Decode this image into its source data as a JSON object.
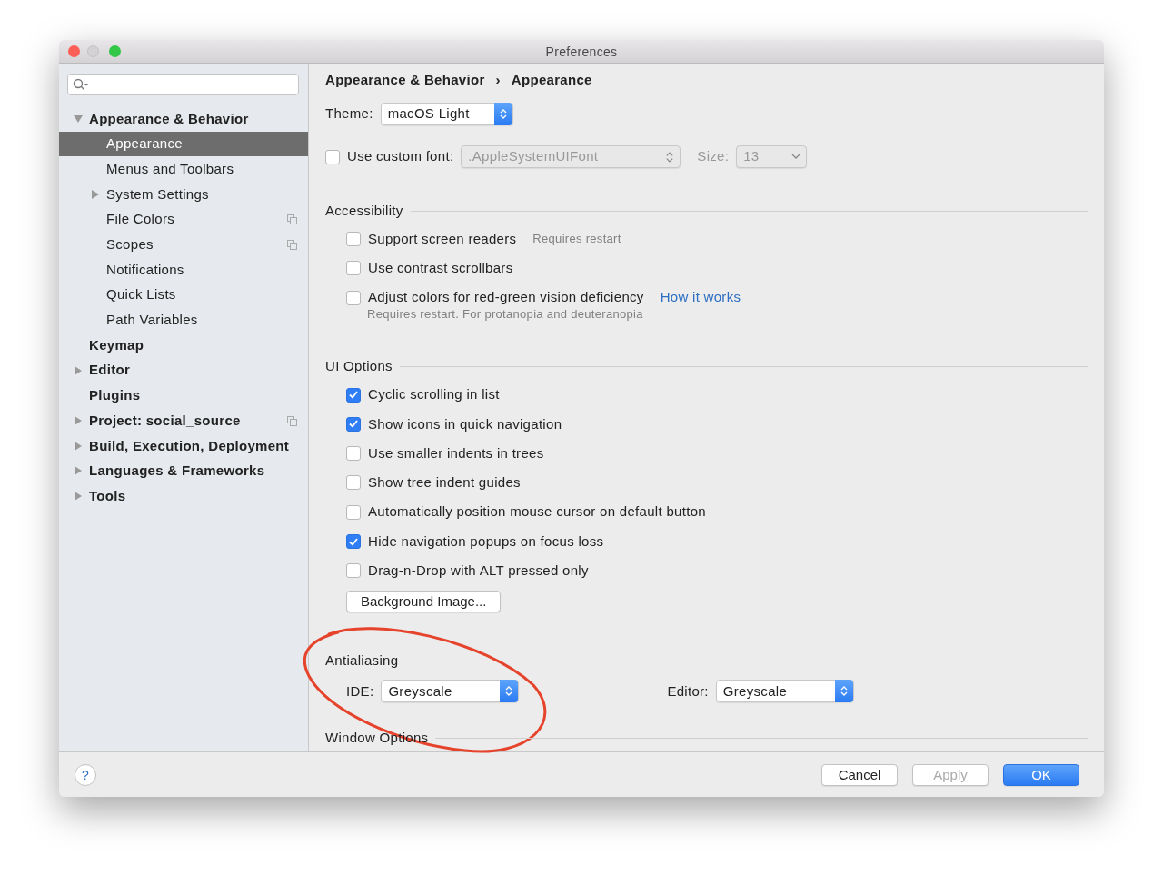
{
  "window": {
    "title": "Preferences"
  },
  "sidebar": {
    "items": [
      {
        "label": "Appearance & Behavior",
        "expanded": true,
        "selected": false,
        "children": [
          {
            "label": "Appearance",
            "selected": true
          },
          {
            "label": "Menus and Toolbars",
            "selected": false
          },
          {
            "label": "System Settings",
            "expanded": false,
            "selected": false
          },
          {
            "label": "File Colors",
            "selected": false,
            "project_level": true
          },
          {
            "label": "Scopes",
            "selected": false,
            "project_level": true
          },
          {
            "label": "Notifications",
            "selected": false
          },
          {
            "label": "Quick Lists",
            "selected": false
          },
          {
            "label": "Path Variables",
            "selected": false
          }
        ]
      },
      {
        "label": "Keymap",
        "selected": false
      },
      {
        "label": "Editor",
        "expanded": false,
        "selected": false
      },
      {
        "label": "Plugins",
        "selected": false
      },
      {
        "label": "Project: social_source",
        "expanded": false,
        "selected": false,
        "project_level": true
      },
      {
        "label": "Build, Execution, Deployment",
        "expanded": false,
        "selected": false
      },
      {
        "label": "Languages & Frameworks",
        "expanded": false,
        "selected": false
      },
      {
        "label": "Tools",
        "expanded": false,
        "selected": false
      }
    ]
  },
  "breadcrumb": [
    "Appearance & Behavior",
    "›",
    "Appearance"
  ],
  "theme": {
    "label": "Theme:",
    "value": "macOS Light"
  },
  "custom_font": {
    "label": "Use custom font:",
    "checked": false,
    "value": ".AppleSystemUIFont",
    "size_label": "Size:",
    "size": "13",
    "disabled": true
  },
  "sections": [
    {
      "title": "Accessibility",
      "items": [
        {
          "kind": "checkbox",
          "label": "Support screen readers",
          "checked": false,
          "hint": "Requires restart"
        },
        {
          "kind": "checkbox",
          "label": "Use contrast scrollbars",
          "checked": false
        },
        {
          "kind": "checkbox",
          "label": "Adjust colors for red-green vision deficiency",
          "checked": false,
          "link": "How it works",
          "note": "Requires restart. For protanopia and deuteranopia"
        }
      ]
    },
    {
      "title": "UI Options",
      "items": [
        {
          "kind": "checkbox",
          "label": "Cyclic scrolling in list",
          "checked": true
        },
        {
          "kind": "checkbox",
          "label": "Show icons in quick navigation",
          "checked": true
        },
        {
          "kind": "checkbox",
          "label": "Use smaller indents in trees",
          "checked": false
        },
        {
          "kind": "checkbox",
          "label": "Show tree indent guides",
          "checked": false
        },
        {
          "kind": "checkbox",
          "label": "Automatically position mouse cursor on default button",
          "checked": false
        },
        {
          "kind": "checkbox",
          "label": "Hide navigation popups on focus loss",
          "checked": true
        },
        {
          "kind": "checkbox",
          "label": "Drag-n-Drop with ALT pressed only",
          "checked": false
        },
        {
          "kind": "button",
          "label": "Background Image..."
        }
      ]
    },
    {
      "title": "Antialiasing",
      "items": [
        {
          "kind": "selects",
          "fields": [
            {
              "label": "IDE:",
              "value": "Greyscale"
            },
            {
              "label": "Editor:",
              "value": "Greyscale"
            }
          ]
        }
      ]
    },
    {
      "title": "Window Options"
    }
  ],
  "footer": {
    "help": "?",
    "buttons": [
      {
        "label": "Cancel",
        "kind": "normal",
        "disabled": false
      },
      {
        "label": "Apply",
        "kind": "normal",
        "disabled": true
      },
      {
        "label": "OK",
        "kind": "default",
        "disabled": false
      }
    ]
  }
}
